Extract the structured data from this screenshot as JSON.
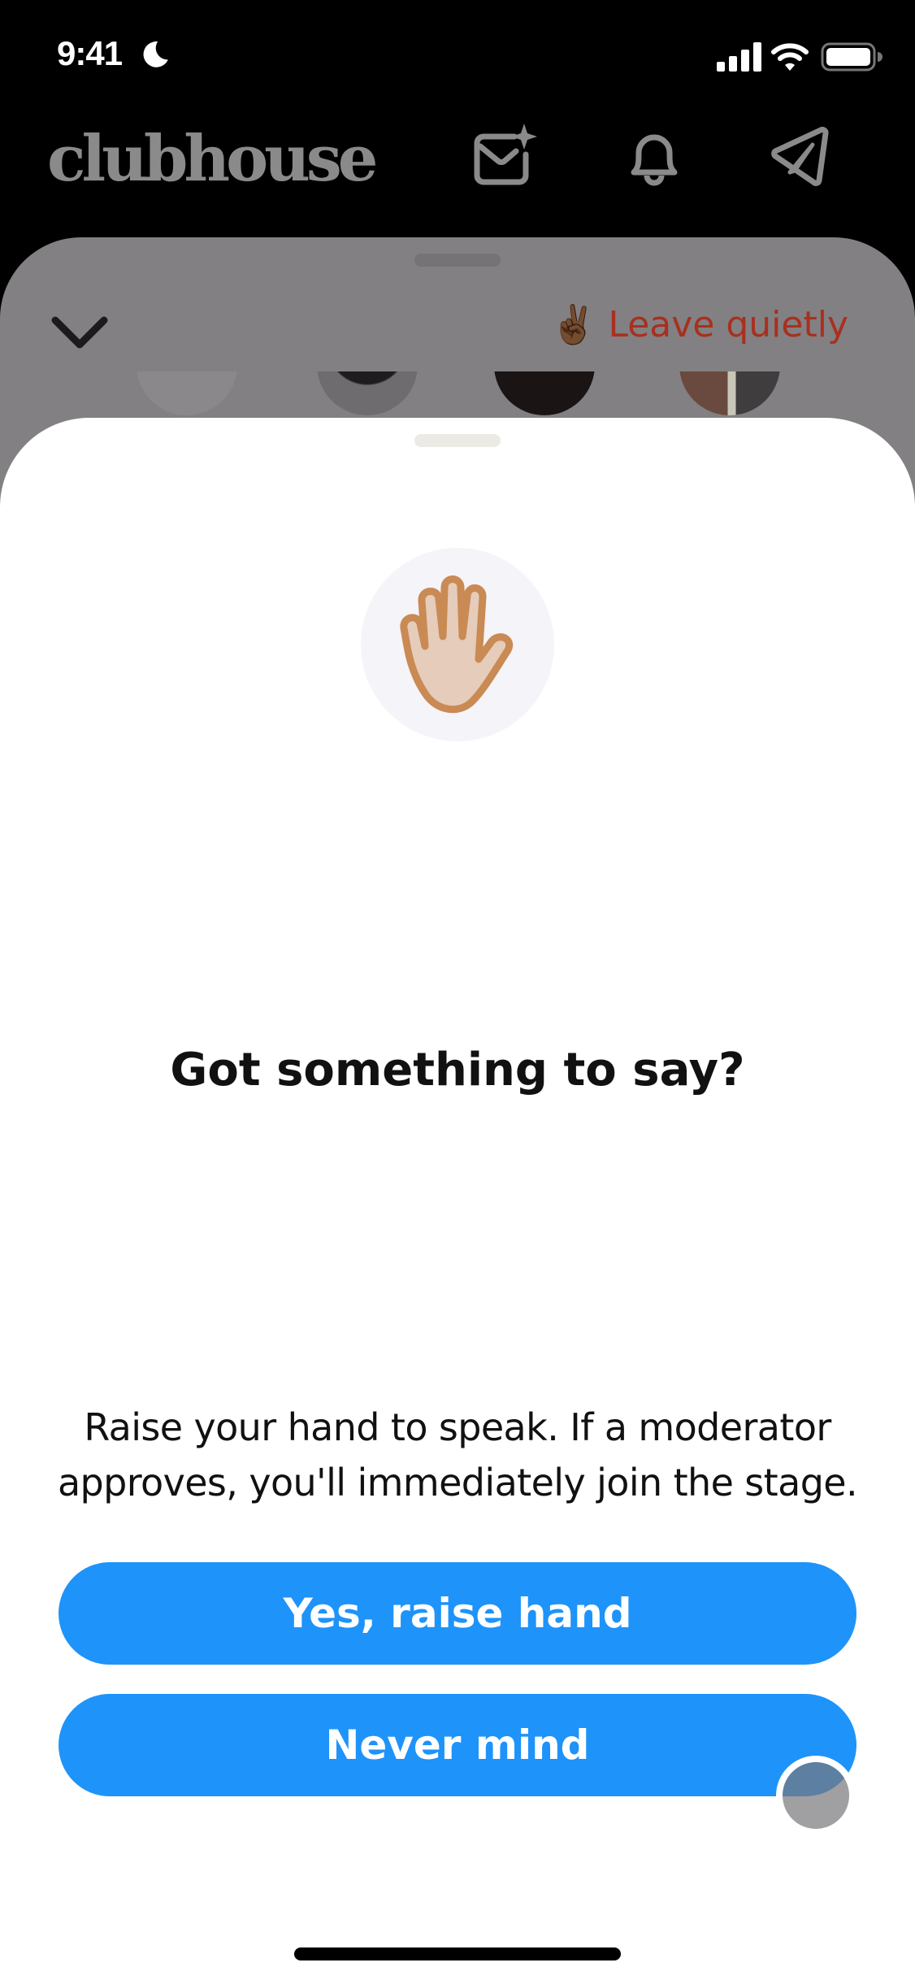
{
  "status_bar": {
    "time": "9:41",
    "focus_icon": "moon-icon",
    "signal_icon": "cellular-signal-icon",
    "wifi_icon": "wifi-icon",
    "battery_icon": "battery-icon"
  },
  "header": {
    "logo_text": "clubhouse",
    "icons": [
      "inbox-sparkle-icon",
      "bell-icon",
      "send-icon"
    ]
  },
  "room": {
    "collapse_icon": "chevron-down-icon",
    "leave_emoji": "✌🏾",
    "leave_label": "Leave quietly",
    "leave_color": "#a8301f"
  },
  "sheet": {
    "icon": "raised-hand-icon",
    "title": "Got something to say?",
    "body": "Raise your hand to speak. If a moderator approves, you'll immediately join the stage.",
    "primary_button": "Yes, raise hand",
    "secondary_button": "Never mind",
    "button_color": "#1e93fa"
  }
}
